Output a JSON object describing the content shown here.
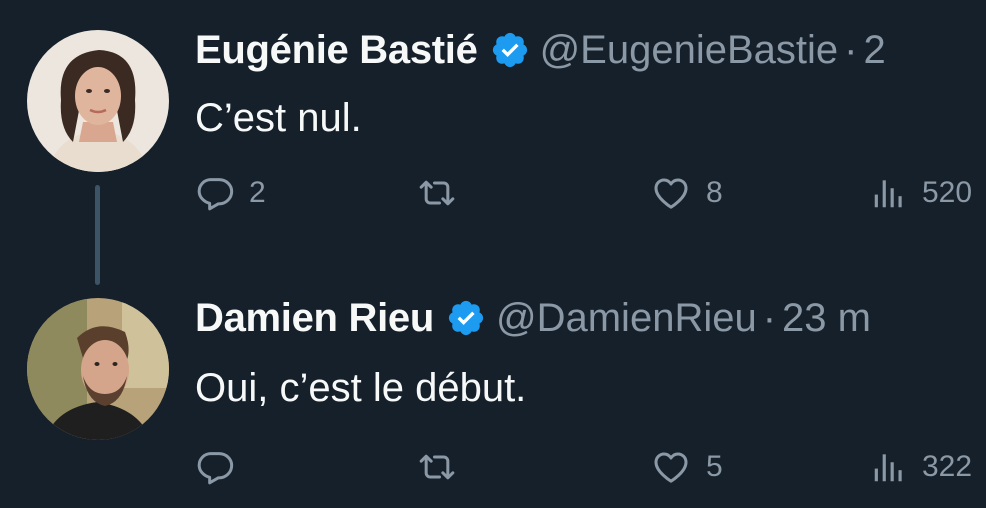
{
  "tweets": [
    {
      "name": "Eugénie Bastié",
      "handle": "@EugenieBastie",
      "separator": "·",
      "time": "2",
      "text": "C’est nul.",
      "reply_count": "2",
      "retweet_count": "",
      "like_count": "8",
      "view_count": "520"
    },
    {
      "name": "Damien Rieu",
      "handle": "@DamienRieu",
      "separator": "·",
      "time": "23 m",
      "text": "Oui, c’est le début.",
      "reply_count": "",
      "retweet_count": "",
      "like_count": "5",
      "view_count": "322"
    }
  ],
  "colors": {
    "background": "#15202b",
    "verified_badge": "#1d9bf0",
    "secondary_text": "#8b98a5",
    "primary_text": "#f7f9f9"
  },
  "icons": [
    "verified-badge-icon",
    "reply-icon",
    "retweet-icon",
    "like-icon",
    "views-icon"
  ]
}
